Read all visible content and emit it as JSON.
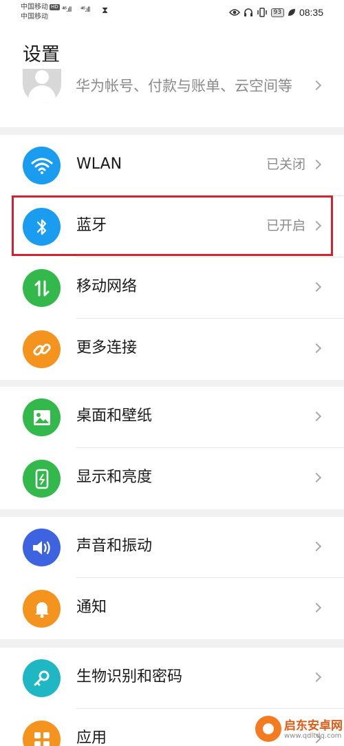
{
  "status_bar": {
    "carrier_1": "中国移动",
    "hd_badge": "HD",
    "carrier_2": "中国移动",
    "signal_1": "⁴⁶.ıll",
    "signal_2": "⁴⁶.ıll",
    "battery": "93",
    "time": "08:35"
  },
  "page": {
    "title": "设置"
  },
  "account": {
    "text": "华为帐号、付款与账单、云空间等"
  },
  "groups": [
    {
      "items": [
        {
          "label": "WLAN",
          "value": "已关闭",
          "icon": "wifi-icon",
          "color": "#1a9cf0"
        },
        {
          "label": "蓝牙",
          "value": "已开启",
          "icon": "bluetooth-icon",
          "color": "#1a9cf0"
        },
        {
          "label": "移动网络",
          "value": "",
          "icon": "mobile-data-icon",
          "color": "#33b94b"
        },
        {
          "label": "更多连接",
          "value": "",
          "icon": "link-icon",
          "color": "#f5931f"
        }
      ]
    },
    {
      "items": [
        {
          "label": "桌面和壁纸",
          "value": "",
          "icon": "image-icon",
          "color": "#33b94b"
        },
        {
          "label": "显示和亮度",
          "value": "",
          "icon": "phone-brightness-icon",
          "color": "#33b94b"
        }
      ]
    },
    {
      "items": [
        {
          "label": "声音和振动",
          "value": "",
          "icon": "speaker-icon",
          "color": "#3e63e0"
        },
        {
          "label": "通知",
          "value": "",
          "icon": "bell-icon",
          "color": "#f5931f"
        }
      ]
    },
    {
      "items": [
        {
          "label": "生物识别和密码",
          "value": "",
          "icon": "key-icon",
          "color": "#1eb7c3"
        },
        {
          "label": "应用",
          "value": "",
          "icon": "apps-icon",
          "color": "#f5931f"
        }
      ]
    }
  ],
  "watermark": {
    "title": "启东安卓网",
    "url": "www.qdltdq.com"
  }
}
